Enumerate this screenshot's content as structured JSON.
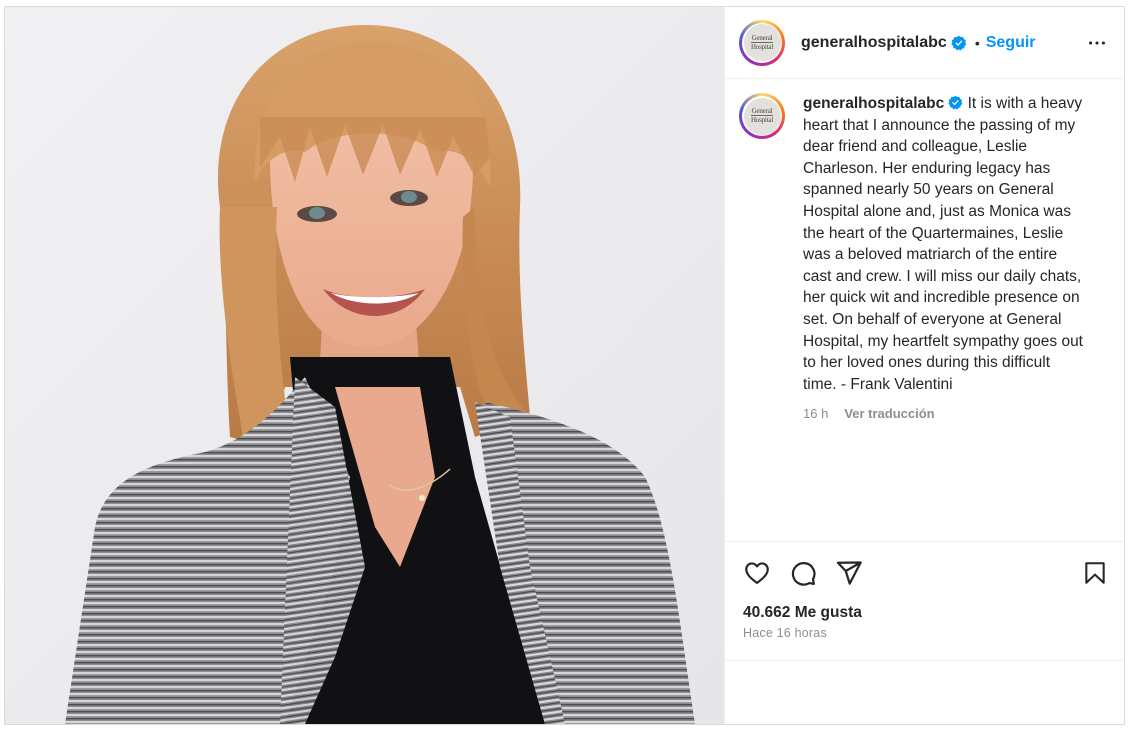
{
  "post": {
    "account": {
      "username": "generalhospitalabc",
      "verified": true,
      "avatar_text_top": "General",
      "avatar_text_bottom": "Hospital"
    },
    "header": {
      "separator": "•",
      "follow_label": "Seguir",
      "more_icon": "more-horizontal-icon"
    },
    "caption": {
      "text": "It is with a heavy heart that I announce the passing of my dear friend and colleague, Leslie Charleson. Her enduring legacy has spanned nearly 50 years on General Hospital alone and, just as Monica was the heart of the Quartermaines, Leslie was a beloved matriarch of the entire cast and crew. I will miss our daily chats, her quick wit and incredible presence on set. On behalf of everyone at General Hospital, my heartfelt sympathy goes out to her loved ones during this difficult time. - Frank Valentini",
      "age": "16 h",
      "translate_label": "Ver traducción"
    },
    "actions": {
      "like_icon": "heart-icon",
      "comment_icon": "comment-icon",
      "share_icon": "share-icon",
      "save_icon": "bookmark-icon"
    },
    "likes_label": "40.662 Me gusta",
    "timestamp": "Hace 16 horas",
    "colors": {
      "link": "#0095f6",
      "verified": "#0095f6",
      "text": "#262626",
      "muted": "#8e8e8e",
      "border": "#dbdbdb"
    }
  }
}
